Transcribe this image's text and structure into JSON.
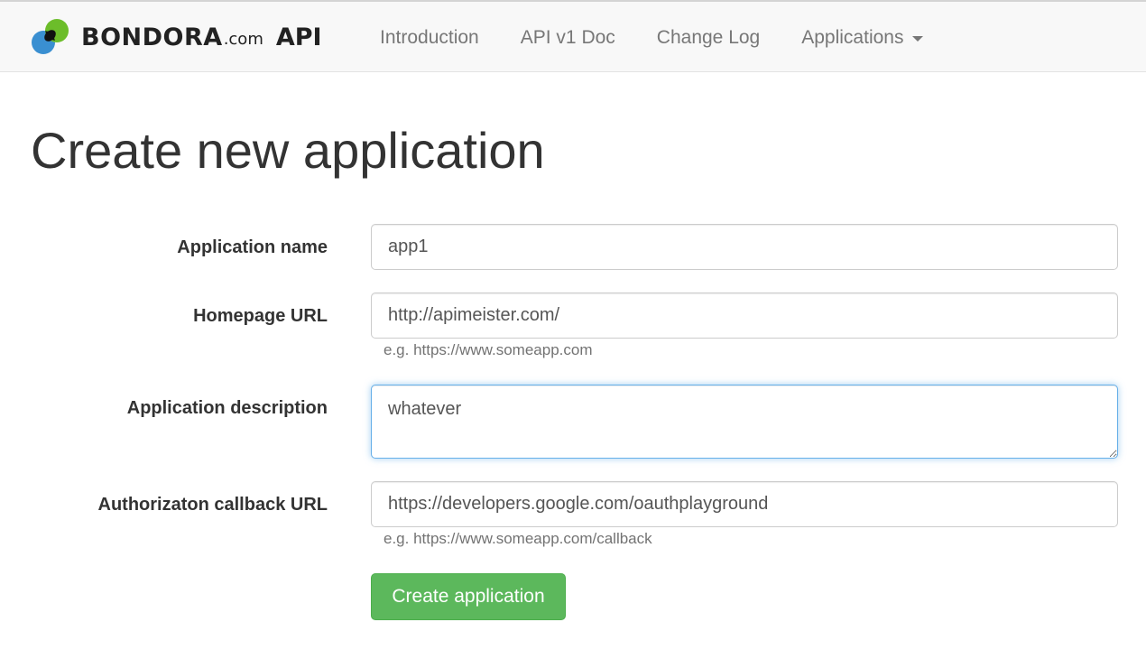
{
  "brand": {
    "name": "BONDORA",
    "domain": ".com",
    "api": "API",
    "logo_colors": [
      "#3a8fd1",
      "#6cbd2a",
      "#111111"
    ]
  },
  "nav": {
    "items": [
      {
        "label": "Introduction"
      },
      {
        "label": "API v1 Doc"
      },
      {
        "label": "Change Log"
      },
      {
        "label": "Applications",
        "has_dropdown": true
      }
    ]
  },
  "page": {
    "title": "Create new application"
  },
  "form": {
    "app_name": {
      "label": "Application name",
      "value": "app1"
    },
    "homepage_url": {
      "label": "Homepage URL",
      "value": "http://apimeister.com/",
      "help": "e.g. https://www.someapp.com"
    },
    "description": {
      "label": "Application description",
      "value": "whatever"
    },
    "callback_url": {
      "label": "Authorizaton callback URL",
      "value": "https://developers.google.com/oauthplayground",
      "help": "e.g. https://www.someapp.com/callback"
    },
    "submit_label": "Create application"
  },
  "colors": {
    "navbar_bg": "#f8f8f8",
    "nav_text": "#777777",
    "focus_border": "#66afe9",
    "success": "#5cb85c"
  }
}
